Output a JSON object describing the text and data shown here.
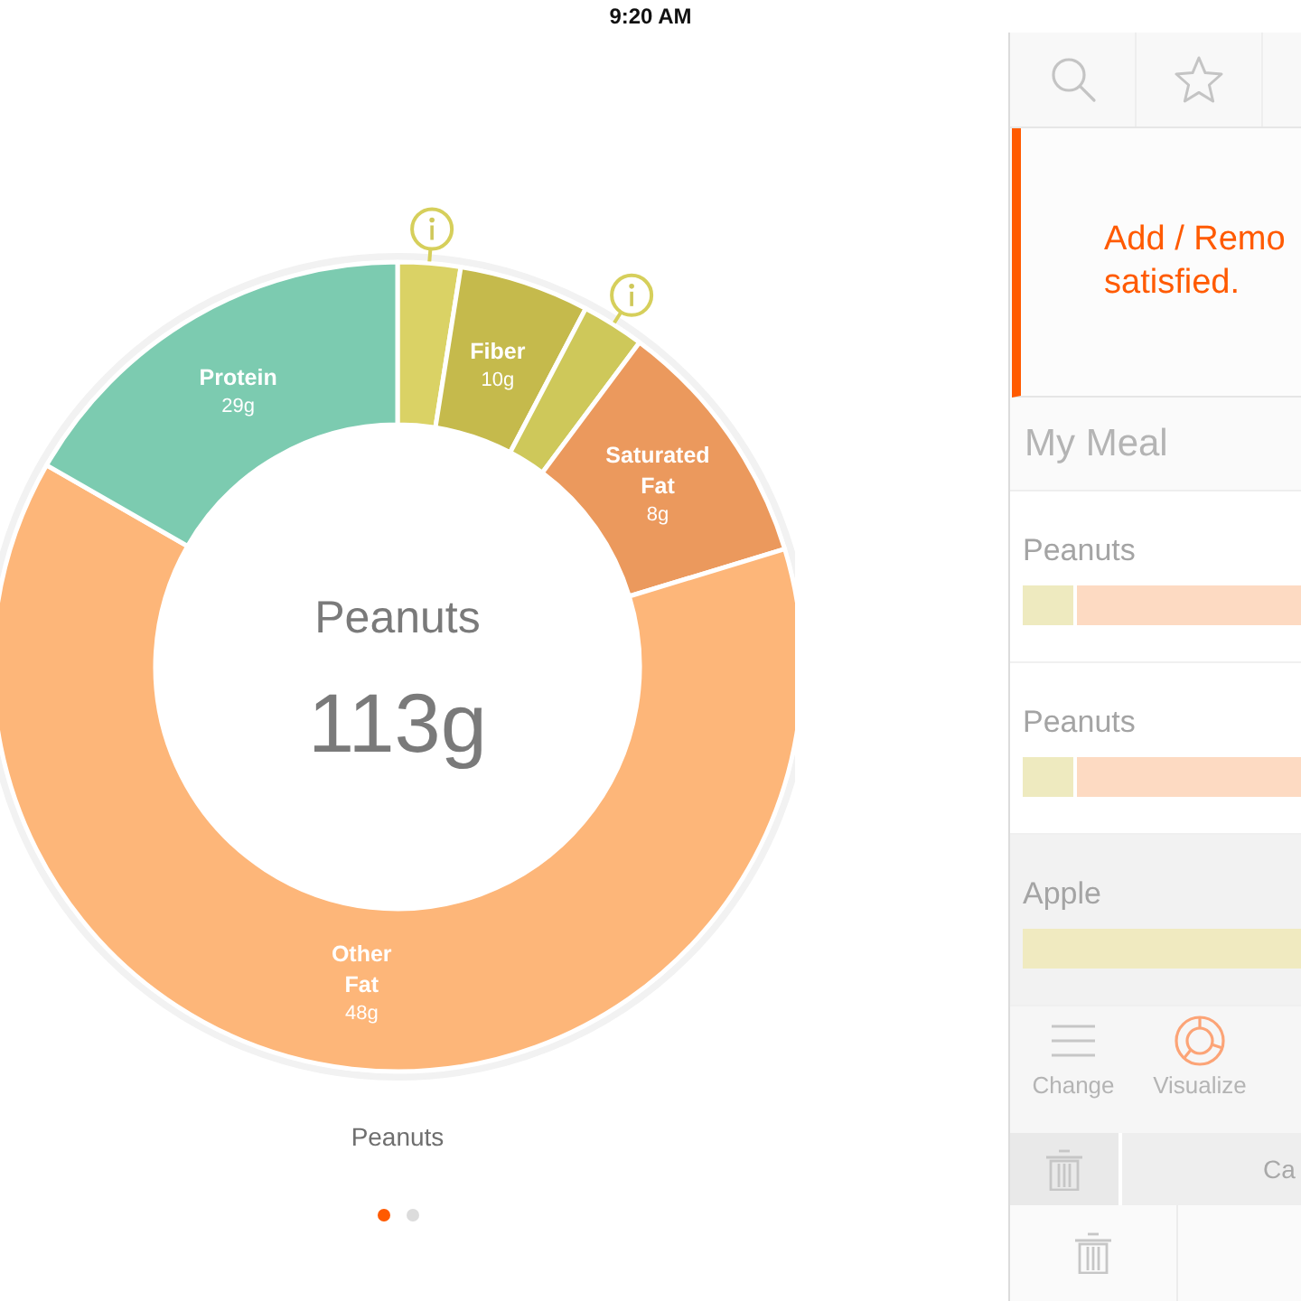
{
  "status_bar": {
    "time": "9:20 AM"
  },
  "chart": {
    "chart_data": {
      "type": "donut",
      "categories": [
        null,
        "Fiber",
        null,
        "Saturated Fat",
        "Other Fat",
        "Protein"
      ],
      "values": [
        2.5,
        5.2,
        2.5,
        10.1,
        63,
        16.7
      ],
      "colors": [
        "#dad265",
        "#c5ba4c",
        "#cec85a",
        "#eb995d",
        "#fdb679",
        "#7ccbb0"
      ]
    },
    "slice_marks": [
      {
        "kind": "info"
      },
      {
        "kind": "amount",
        "text": "10g"
      },
      {
        "kind": "info"
      },
      {
        "kind": "amount",
        "text": "8g"
      },
      {
        "kind": "amount",
        "text": "48g"
      },
      {
        "kind": "amount",
        "text": "29g"
      }
    ],
    "center_title": "Peanuts",
    "center_value": "113g",
    "caption": "Peanuts"
  },
  "pager": [
    {
      "selected": true
    },
    {
      "selected": false
    }
  ],
  "sidebar": {
    "message": "Add / Remo\nsatisfied.",
    "meal": {
      "title": "My Meal",
      "items": [
        {
          "name": "Peanuts",
          "selected": false,
          "segments": [
            {
              "color": "#eeeabf",
              "level": 0.18
            },
            {
              "color": "#fddac2",
              "level": 0.82
            }
          ]
        },
        {
          "name": "Peanuts",
          "selected": false,
          "segments": [
            {
              "color": "#eeeabf",
              "level": 0.18
            },
            {
              "color": "#fddac2",
              "level": 0.82
            }
          ]
        },
        {
          "name": "Apple",
          "selected": true,
          "segments": [
            {
              "color": "#f0eac0",
              "level": 1
            }
          ]
        }
      ]
    },
    "tools": [
      {
        "kind": "list",
        "label": "Change",
        "selected": false
      },
      {
        "kind": "donut",
        "label": "Visualize",
        "selected": true
      }
    ],
    "action_row": {
      "button_label": "Ca"
    }
  }
}
